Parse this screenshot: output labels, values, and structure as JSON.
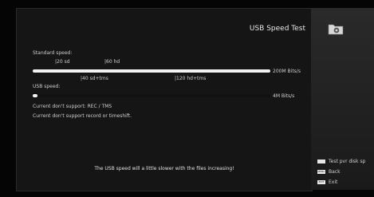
{
  "header": {
    "title": "USB Speed Test"
  },
  "standard": {
    "label": "Standard speed:",
    "markers_top": [
      "|20 sd",
      "|60 hd"
    ],
    "markers_bottom": [
      "|40 sd+tms",
      "|120 hd+tms"
    ],
    "value_label": "200M Bits/s",
    "progress": 1.0
  },
  "usb": {
    "label": "USB speed:",
    "value_label": "4M Bits/s",
    "progress": 0.02
  },
  "messages": {
    "line1": "Current don't support: REC / TMS",
    "line2": "Current don't support record or timeshift."
  },
  "footer": {
    "note": "The USB speed will a little slower with the files increasing!"
  },
  "sidebar": {
    "icon": "folder-icon",
    "items": [
      {
        "key": "white-key",
        "label": "Test pvr disk sp"
      },
      {
        "key": "menu-key",
        "label": "Back"
      },
      {
        "key": "exit-key",
        "label": "Exit"
      }
    ]
  }
}
